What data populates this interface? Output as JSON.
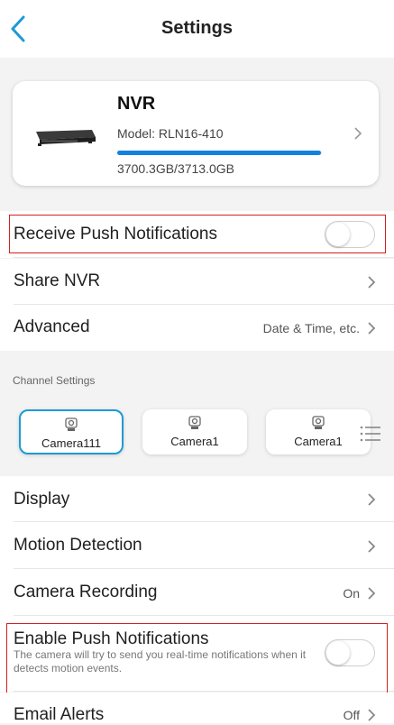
{
  "header": {
    "title": "Settings",
    "back_icon": "back-arrow-icon",
    "accent": "#1e9ad6"
  },
  "device": {
    "name": "NVR",
    "model": "Model: RLN16-410",
    "storage_text": "3700.3GB/3713.0GB",
    "storage_used_fraction": 0.9966,
    "bar_color": "#1480e0"
  },
  "settings": {
    "receive_push": {
      "label": "Receive Push Notifications",
      "enabled": false
    },
    "share_nvr": {
      "label": "Share NVR"
    },
    "advanced": {
      "label": "Advanced",
      "value": "Date & Time, etc."
    }
  },
  "channel_settings": {
    "section_label": "Channel Settings",
    "cameras": [
      {
        "name": "Camera111",
        "selected": true
      },
      {
        "name": "Camera1",
        "selected": false
      },
      {
        "name": "Camera1",
        "selected": false
      }
    ]
  },
  "channel_rows": {
    "display": {
      "label": "Display"
    },
    "motion_detection": {
      "label": "Motion Detection"
    },
    "camera_recording": {
      "label": "Camera Recording",
      "value": "On"
    },
    "enable_push": {
      "label": "Enable Push Notifications",
      "description": "The camera will try to send you real-time notifications when it detects motion events.",
      "enabled": false
    },
    "email_alerts": {
      "label": "Email Alerts",
      "value": "Off"
    }
  },
  "highlight_color": "#d42020"
}
